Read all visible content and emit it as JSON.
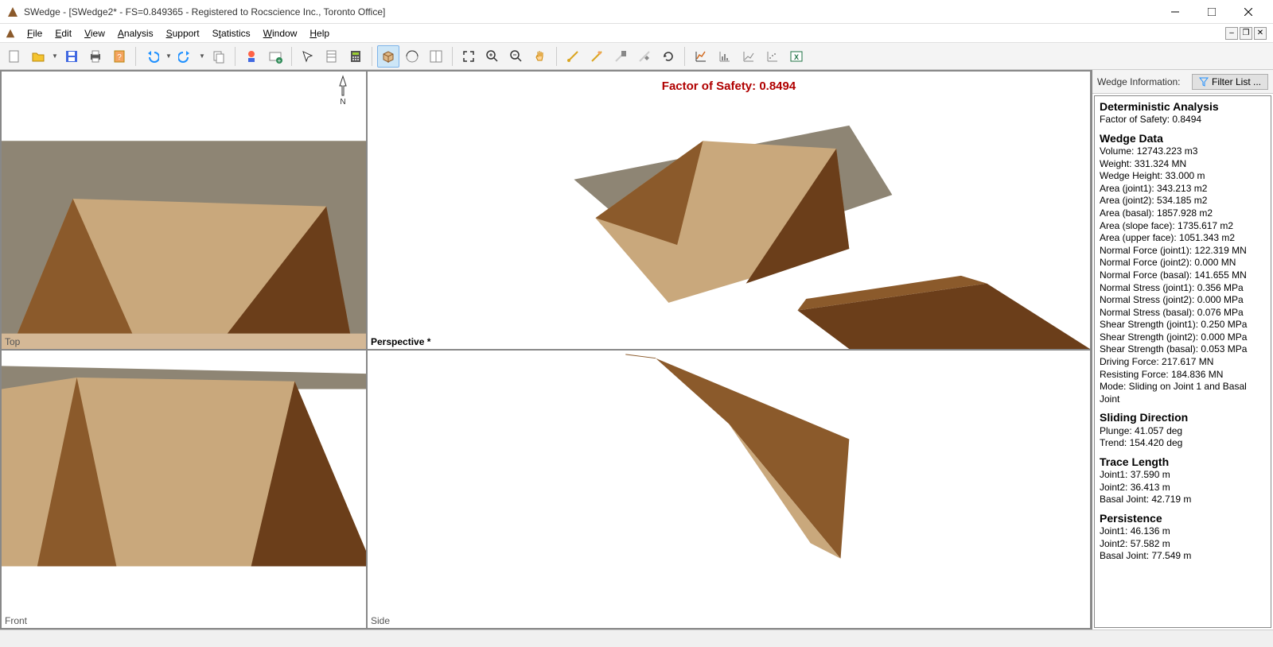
{
  "window": {
    "title": "SWedge - [SWedge2* - FS=0.849365 - Registered to Rocscience Inc., Toronto Office]"
  },
  "menu": {
    "items": [
      "File",
      "Edit",
      "View",
      "Analysis",
      "Support",
      "Statistics",
      "Window",
      "Help"
    ]
  },
  "viewports": {
    "top": "Top",
    "perspective": "Perspective *",
    "front": "Front",
    "side": "Side",
    "fos_label": "Factor of Safety: 0.8494"
  },
  "sidebar": {
    "header_label": "Wedge Information:",
    "filter_btn": "Filter List ...",
    "sections": {
      "analysis_hdr": "Deterministic Analysis",
      "fos": "Factor of Safety: 0.8494",
      "wedge_hdr": "Wedge Data",
      "wedge": [
        "Volume: 12743.223 m3",
        "Weight: 331.324 MN",
        "Wedge Height: 33.000 m",
        "Area (joint1): 343.213 m2",
        "Area (joint2): 534.185 m2",
        "Area (basal): 1857.928 m2",
        "Area (slope face): 1735.617 m2",
        "Area (upper face): 1051.343 m2",
        "Normal Force (joint1): 122.319 MN",
        "Normal Force (joint2): 0.000 MN",
        "Normal Force (basal): 141.655 MN",
        "Normal Stress (joint1): 0.356 MPa",
        "Normal Stress (joint2): 0.000 MPa",
        "Normal Stress (basal): 0.076 MPa",
        "Shear Strength (joint1): 0.250 MPa",
        "Shear Strength (joint2): 0.000 MPa",
        "Shear Strength (basal): 0.053 MPa",
        "Driving Force: 217.617 MN",
        "Resisting Force: 184.836 MN",
        "Mode: Sliding on Joint 1 and Basal Joint"
      ],
      "sliding_hdr": "Sliding Direction",
      "sliding": [
        "Plunge: 41.057 deg",
        "Trend: 154.420 deg"
      ],
      "trace_hdr": "Trace Length",
      "trace": [
        "Joint1: 37.590 m",
        "Joint2: 36.413 m",
        "Basal Joint: 42.719 m"
      ],
      "persist_hdr": "Persistence",
      "persist": [
        "Joint1: 46.136 m",
        "Joint2: 57.582 m",
        "Basal Joint: 77.549 m"
      ]
    }
  }
}
